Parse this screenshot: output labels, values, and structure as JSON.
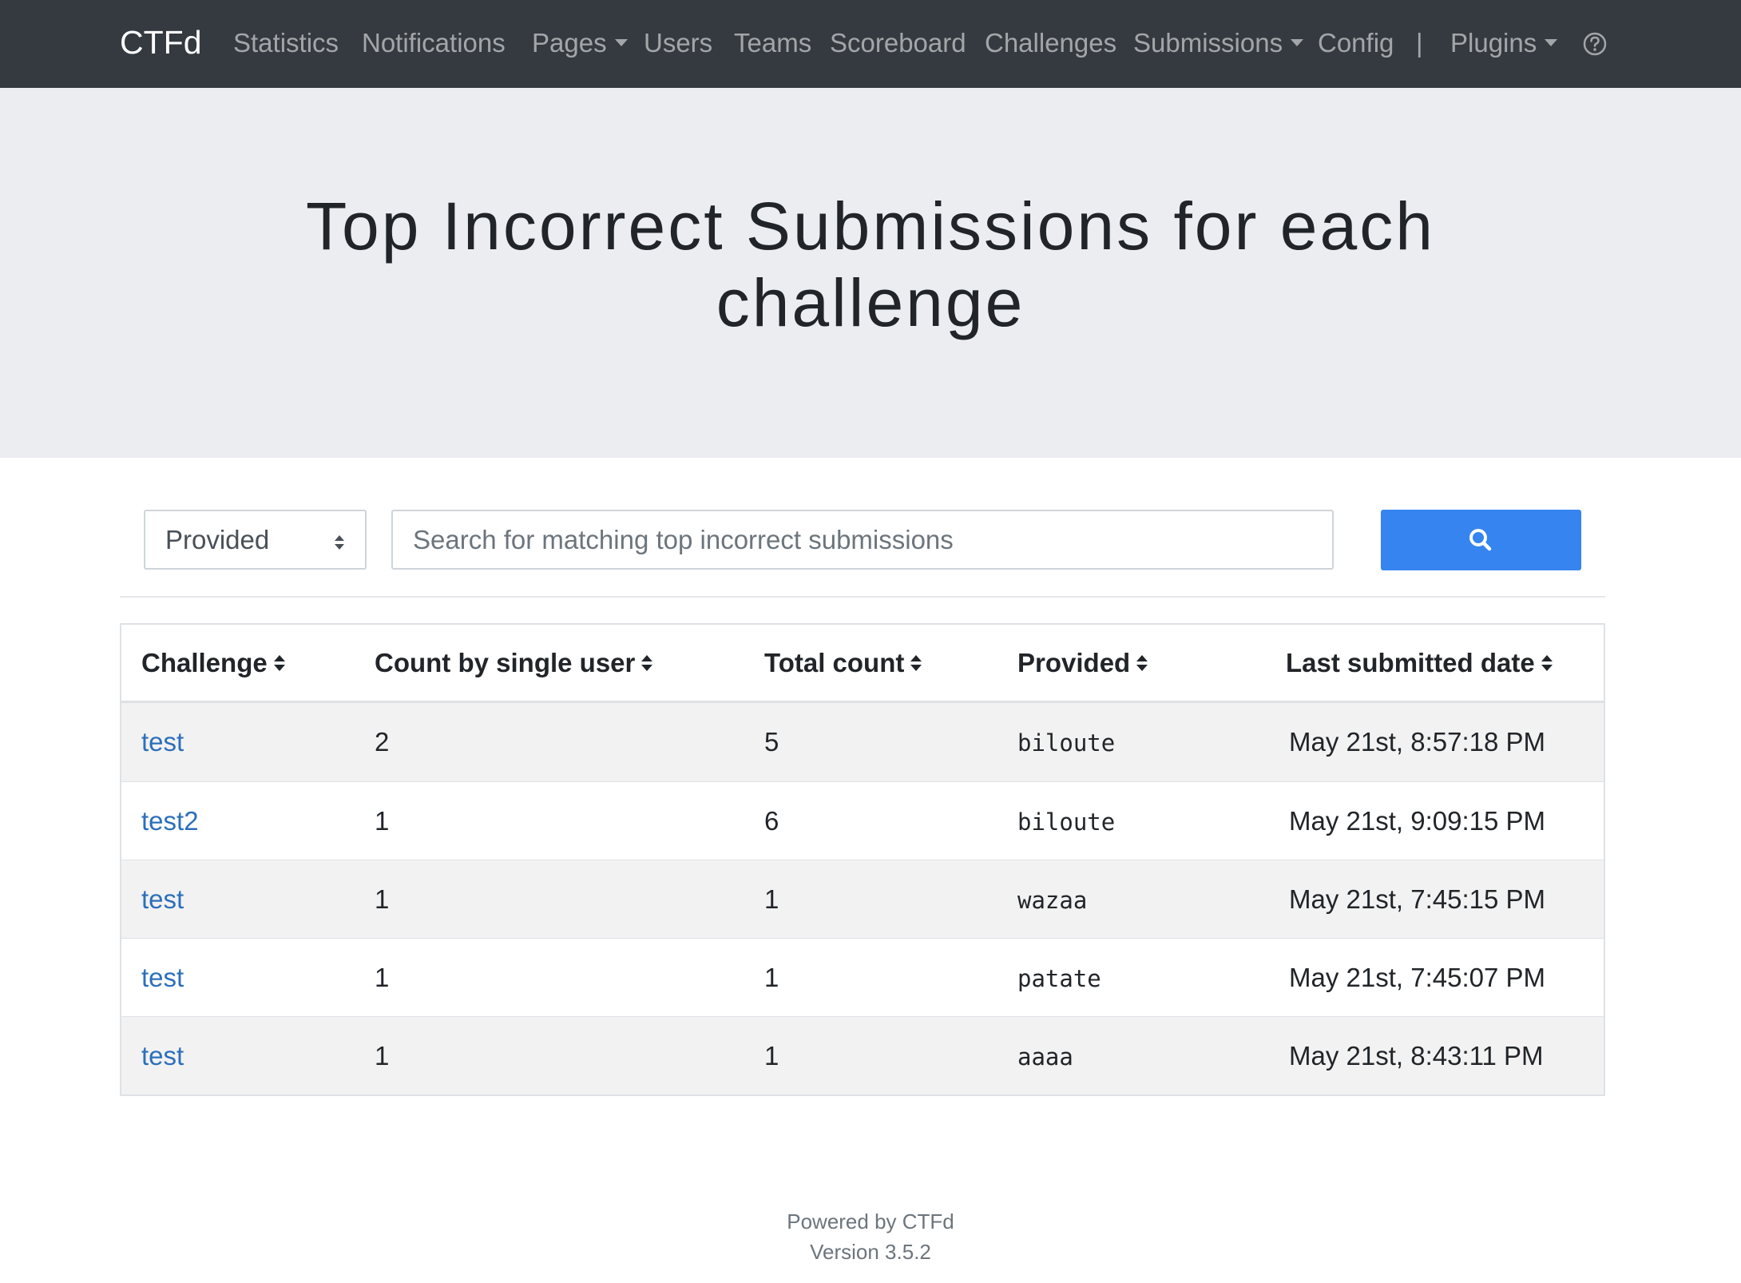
{
  "navbar": {
    "brand": "CTFd",
    "items": [
      {
        "label": "Statistics"
      },
      {
        "label": "Notifications"
      },
      {
        "label": "Pages"
      },
      {
        "label": "Users"
      },
      {
        "label": "Teams"
      },
      {
        "label": "Scoreboard"
      },
      {
        "label": "Challenges"
      },
      {
        "label": "Submissions"
      },
      {
        "label": "Config"
      },
      {
        "label": "|"
      },
      {
        "label": "Plugins"
      }
    ],
    "help_icon": "question-circle-icon"
  },
  "header": {
    "title_line1": "Top Incorrect Submissions for each",
    "title_line2": "challenge"
  },
  "search": {
    "field_selected": "Provided",
    "placeholder": "Search for matching top incorrect submissions",
    "value": "",
    "button_icon": "search-icon",
    "button_color": "#3584f0"
  },
  "table": {
    "columns": [
      "Challenge",
      "Count by single user",
      "Total count",
      "Provided",
      "Last submitted date"
    ],
    "rows": [
      {
        "challenge": "test",
        "count_single": "2",
        "total": "5",
        "provided": "biloute",
        "date": "May 21st, 8:57:18 PM"
      },
      {
        "challenge": "test2",
        "count_single": "1",
        "total": "6",
        "provided": "biloute",
        "date": "May 21st, 9:09:15 PM"
      },
      {
        "challenge": "test",
        "count_single": "1",
        "total": "1",
        "provided": "wazaa",
        "date": "May 21st, 7:45:15 PM"
      },
      {
        "challenge": "test",
        "count_single": "1",
        "total": "1",
        "provided": "patate",
        "date": "May 21st, 7:45:07 PM"
      },
      {
        "challenge": "test",
        "count_single": "1",
        "total": "1",
        "provided": "aaaa",
        "date": "May 21st, 8:43:11 PM"
      }
    ]
  },
  "footer": {
    "powered": "Powered by CTFd",
    "version": "Version 3.5.2"
  },
  "colors": {
    "navbar": "#343a40",
    "jumbotron": "#ebedf0",
    "link": "#2c6fbb",
    "primary": "#3584f0"
  }
}
